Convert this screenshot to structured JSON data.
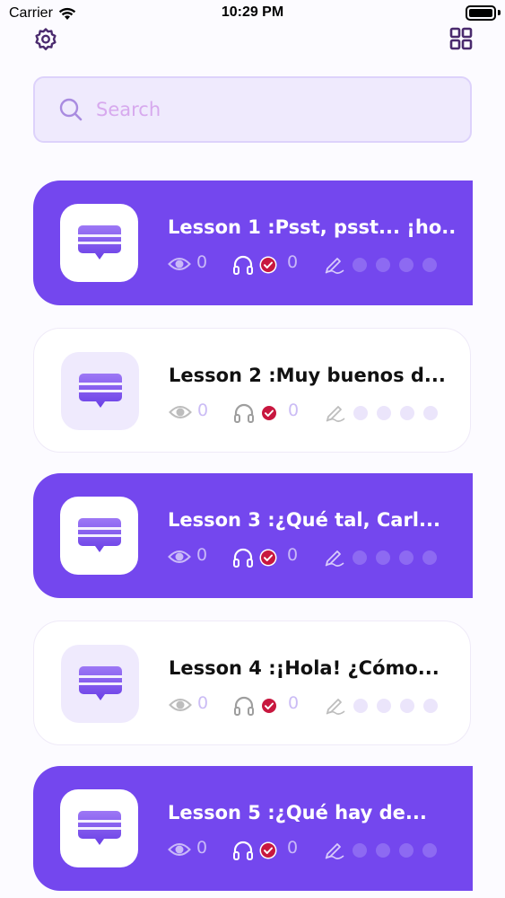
{
  "status_bar": {
    "carrier": "Carrier",
    "time": "10:29 PM"
  },
  "search": {
    "placeholder": "Search",
    "value": ""
  },
  "icons": {
    "settings": "gear-icon",
    "grid": "grid-view-icon",
    "search": "search-icon",
    "lesson": "chat-bubble-icon",
    "views": "eye-icon",
    "audio": "headphones-icon",
    "completed": "check-badge-icon",
    "writing": "pen-writing-icon"
  },
  "colors": {
    "accent": "#7447ee",
    "card_white": "#ffffff",
    "check_badge": "#c8173f",
    "search_bg": "#efeafd"
  },
  "lessons": [
    {
      "title": "Lesson 1 :Psst, psst... ¡ho...",
      "views": "0",
      "audio_count": "0",
      "highlighted": true
    },
    {
      "title": "Lesson 2 :Muy buenos d...",
      "views": "0",
      "audio_count": "0",
      "highlighted": false
    },
    {
      "title": "Lesson 3 :¿Qué tal, Carl...",
      "views": "0",
      "audio_count": "0",
      "highlighted": true
    },
    {
      "title": "Lesson 4 :¡Hola! ¿Cómo...",
      "views": "0",
      "audio_count": "0",
      "highlighted": false
    },
    {
      "title": "Lesson 5 :¿Qué hay de...",
      "views": "0",
      "audio_count": "0",
      "highlighted": true
    }
  ]
}
